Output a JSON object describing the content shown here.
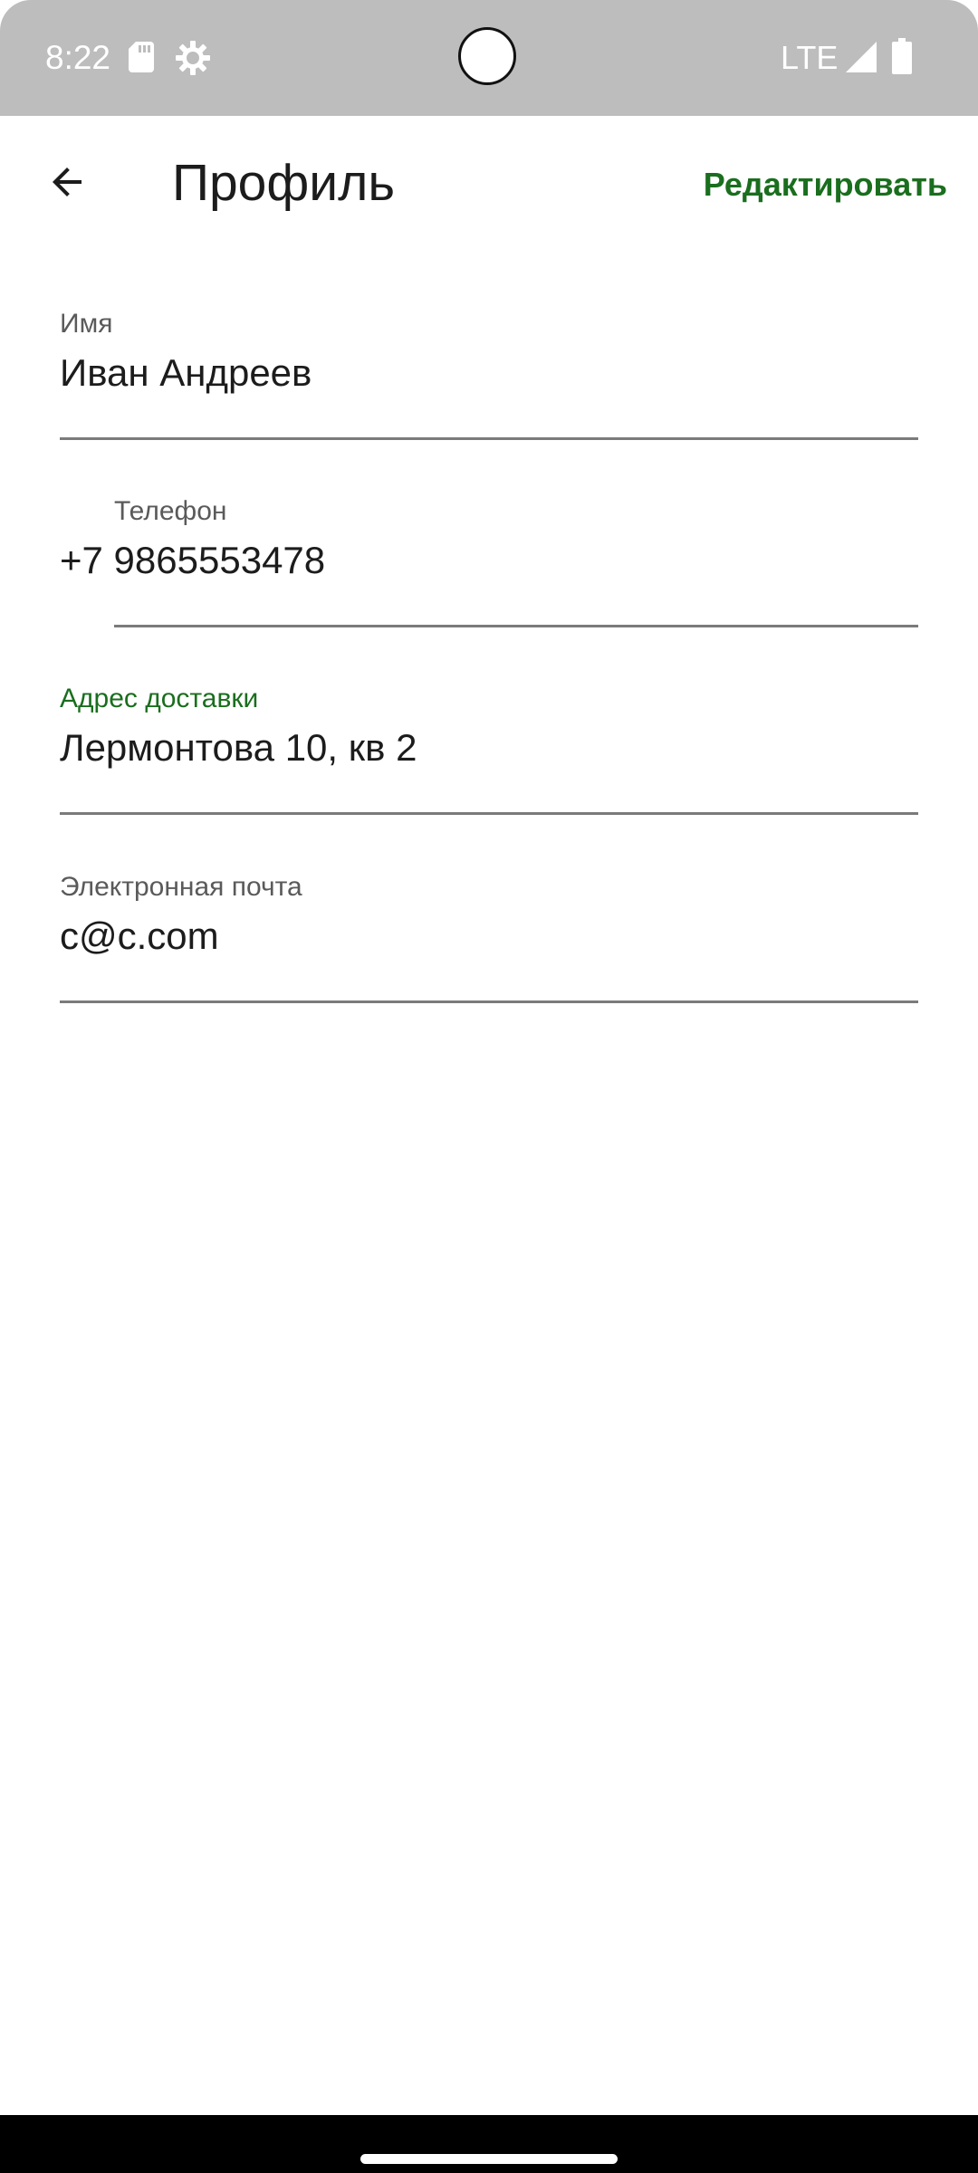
{
  "status_bar": {
    "time": "8:22",
    "network": "LTE",
    "icons": [
      "sd-card-icon",
      "gear-icon",
      "signal-icon",
      "battery-icon"
    ]
  },
  "app_bar": {
    "title": "Профиль",
    "edit_label": "Редактировать",
    "back_icon": "arrow-back-icon"
  },
  "fields": [
    {
      "label": "Имя",
      "value": "Иван Андреев"
    },
    {
      "label": "Телефон",
      "value": "+7 9865553478"
    },
    {
      "label": "Адрес доставки",
      "value": "Лермонтова 10, кв 2"
    },
    {
      "label": "Электронная почта",
      "value": "c@c.com"
    }
  ],
  "colors": {
    "accent": "#1a6e1e",
    "status_bar": "#bdbdbd",
    "text": "#1c1c1c",
    "label": "#5a5a5a"
  }
}
